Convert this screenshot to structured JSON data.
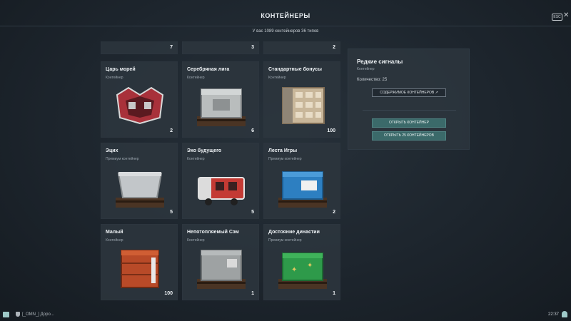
{
  "header": {
    "title": "КОНТЕЙНЕРЫ",
    "esc_label": "ESC",
    "close_icon": "close-icon"
  },
  "subtitle": "У вас 1089 контейнеров 36 типов",
  "top_row_counts": [
    "7",
    "3",
    "2"
  ],
  "containers": [
    {
      "name": "Царь морей",
      "type": "Контейнер",
      "count": "2",
      "icon": "crown-container-icon",
      "color": "#b53a3a"
    },
    {
      "name": "Серебряная лига",
      "type": "Контейнер",
      "count": "6",
      "icon": "silver-crate-icon",
      "color": "#b9bdbd"
    },
    {
      "name": "Стандартные бонусы",
      "type": "Контейнер",
      "count": "100",
      "icon": "drawer-crate-icon",
      "color": "#c9b79a"
    },
    {
      "name": "Эцих",
      "type": "Премиум контейнер",
      "count": "5",
      "icon": "tub-container-icon",
      "color": "#c2c6c9"
    },
    {
      "name": "Эхо будущего",
      "type": "Контейнер",
      "count": "5",
      "icon": "truck-container-icon",
      "color": "#c43a34"
    },
    {
      "name": "Леста Игры",
      "type": "Премиум контейнер",
      "count": "2",
      "icon": "blue-crate-icon",
      "color": "#2d7fc1"
    },
    {
      "name": "Малый",
      "type": "Контейнер",
      "count": "100",
      "icon": "small-crate-icon",
      "color": "#b84a28"
    },
    {
      "name": "Непотопляемый Сэм",
      "type": "Контейнер",
      "count": "1",
      "icon": "grey-crate-icon",
      "color": "#9ea2a3"
    },
    {
      "name": "Достояние династии",
      "type": "Премиум контейнер",
      "count": "1",
      "icon": "green-crate-icon",
      "color": "#2e9a4a"
    }
  ],
  "details": {
    "name": "Редкие сигналы",
    "type": "Контейнер",
    "quantity": "Количество: 25",
    "contents_button": "СОДЕРЖИМОЕ КОНТЕЙНЕРОВ ↗",
    "open_one": "ОТКРЫТЬ КОНТЕЙНЕР",
    "open_many": "ОТКРЫТЬ 25 КОНТЕЙНЕРОВ"
  },
  "footer": {
    "chat_text": "[_OMN_] Доро...",
    "time": "22:37"
  },
  "colors": {
    "accent_button": "#3b6a6a",
    "background": "#1d252d",
    "card": "#2c353e"
  }
}
